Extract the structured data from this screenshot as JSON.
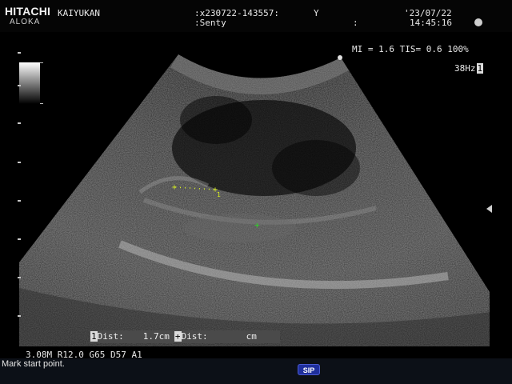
{
  "header": {
    "brand": "HITACHI",
    "brand_sub": "ALOKA",
    "institution": "KAIYUKAN",
    "patient_id": ":x230722-143557:",
    "sex": "Y",
    "patient_name": ":Senty",
    "field_sep": ":",
    "date": "'23/07/22",
    "time": "14:45:16"
  },
  "indices": {
    "mi_tis_power": "MI = 1.6 TIS= 0.6 100%",
    "frame_rate": "38Hz",
    "frame_index": "1"
  },
  "measurement": {
    "marker1_label": "1",
    "dist1_label": "Dist:",
    "dist1_value": "1.7cm",
    "marker2_label": "+",
    "dist2_label": "Dist:",
    "dist2_unit": "cm",
    "caliper_index": "1"
  },
  "params": "3.08M R12.0 G65 D57 A1",
  "status": {
    "message": "Mark start point.",
    "sip_label": "SIP"
  },
  "colors": {
    "caliper": "#d8f020",
    "cursor": "#33d02a",
    "sip_button": "#1f2f9c"
  }
}
